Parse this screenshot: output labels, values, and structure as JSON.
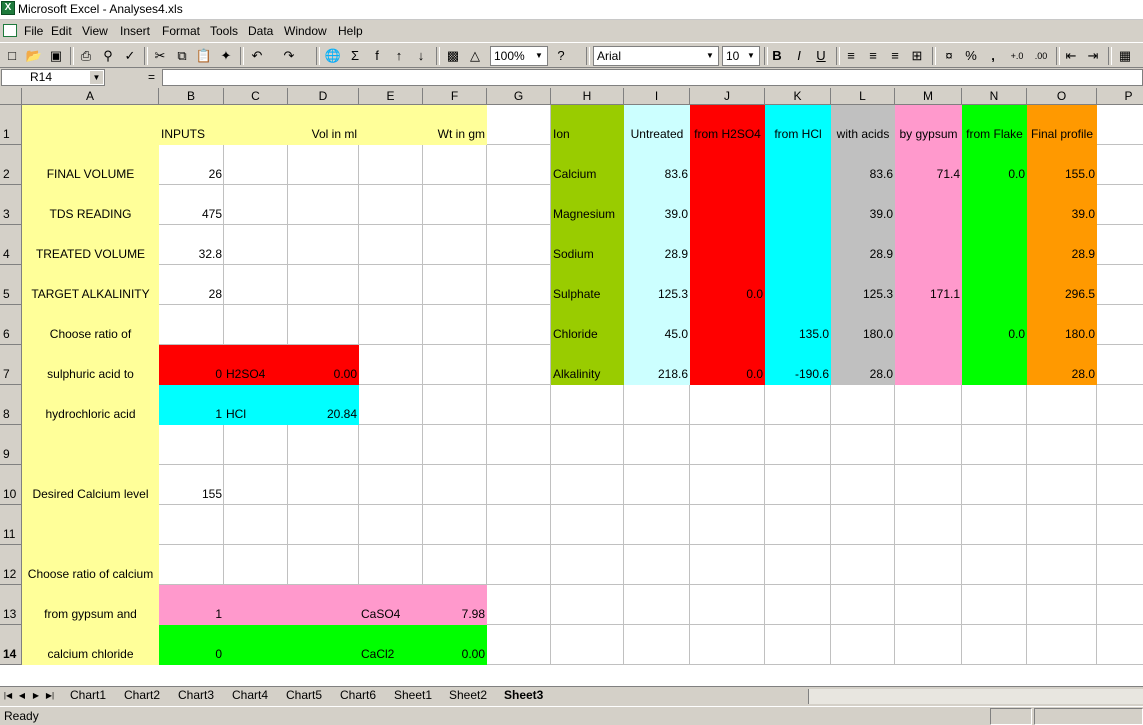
{
  "window": {
    "title": "Microsoft Excel - Analyses4.xls"
  },
  "menu": [
    "File",
    "Edit",
    "View",
    "Insert",
    "Format",
    "Tools",
    "Data",
    "Window",
    "Help"
  ],
  "toolbar": {
    "zoom": "100%",
    "font": "Arial",
    "font_size": "10"
  },
  "formula_bar": {
    "name_box": "R14",
    "equals": "=",
    "content": ""
  },
  "columns": [
    "A",
    "B",
    "C",
    "D",
    "E",
    "F",
    "G",
    "H",
    "I",
    "J",
    "K",
    "L",
    "M",
    "N",
    "O",
    "P"
  ],
  "rows": [
    "1",
    "2",
    "3",
    "4",
    "5",
    "6",
    "7",
    "8",
    "9",
    "10",
    "11",
    "12",
    "13",
    "14"
  ],
  "selected_row": "14",
  "colors": {
    "yellow": "#ffff99",
    "red": "#ff0000",
    "cyan": "#00ffff",
    "pink": "#ff99cc",
    "green": "#00ff00",
    "olive": "#99cc00",
    "light_cyan": "#ccffff",
    "gray": "#c0c0c0",
    "orange": "#ff9900"
  },
  "inputs": {
    "header_inputs": "INPUTS",
    "header_vol": "Vol in ml",
    "header_wt": "Wt in gm",
    "final_volume_label": "FINAL VOLUME",
    "final_volume": "26",
    "tds_label": "TDS READING",
    "tds": "475",
    "treated_volume_label": "TREATED VOLUME",
    "treated_volume": "32.8",
    "target_alk_label": "TARGET ALKALINITY",
    "target_alk": "28",
    "ratio_acid_1": "Choose ratio of",
    "ratio_acid_2": "sulphuric acid to",
    "ratio_acid_3": "hydrochloric acid",
    "h2so4_ratio": "0",
    "h2so4_label": "H2SO4",
    "h2so4_vol": "0.00",
    "hcl_ratio": "1",
    "hcl_label": "HCl",
    "hcl_vol": "20.84",
    "calcium_label": "Desired Calcium level",
    "calcium_level": "155",
    "ratio_ca_1": "Choose ratio of calcium",
    "ratio_ca_2": "from gypsum and",
    "ratio_ca_3": "calcium chloride",
    "gypsum_ratio": "1",
    "caso4_label": "CaSO4",
    "caso4_wt": "7.98",
    "cacl2_ratio": "0",
    "cacl2_label": "CaCl2",
    "cacl2_wt": "0.00"
  },
  "profile": {
    "headers": [
      "Ion",
      "Untreated",
      "from H2SO4",
      "from HCl",
      "with acids",
      "by gypsum",
      "from Flake",
      "Final profile"
    ],
    "rows": [
      [
        "Calcium",
        "83.6",
        "",
        "",
        "83.6",
        "71.4",
        "0.0",
        "155.0"
      ],
      [
        "Magnesium",
        "39.0",
        "",
        "",
        "39.0",
        "",
        "",
        "39.0"
      ],
      [
        "Sodium",
        "28.9",
        "",
        "",
        "28.9",
        "",
        "",
        "28.9"
      ],
      [
        "Sulphate",
        "125.3",
        "0.0",
        "",
        "125.3",
        "171.1",
        "",
        "296.5"
      ],
      [
        "Chloride",
        "45.0",
        "",
        "135.0",
        "180.0",
        "",
        "0.0",
        "180.0"
      ],
      [
        "Alkalinity",
        "218.6",
        "0.0",
        "-190.6",
        "28.0",
        "",
        "",
        "28.0"
      ]
    ]
  },
  "sheet_tabs": [
    "Chart1",
    "Chart2",
    "Chart3",
    "Chart4",
    "Chart5",
    "Chart6",
    "Sheet1",
    "Sheet2",
    "Sheet3"
  ],
  "active_sheet": "Sheet3",
  "status": {
    "text": "Ready"
  }
}
